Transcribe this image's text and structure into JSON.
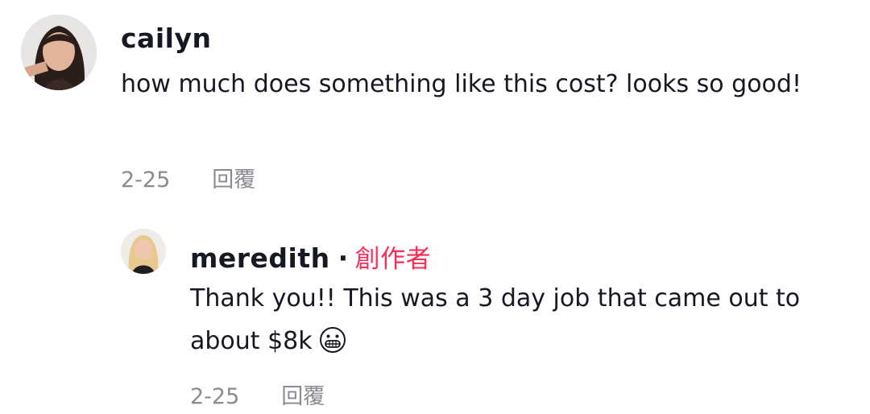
{
  "comments": [
    {
      "username": "cailyn",
      "text": "how much does something like this cost? looks so good!",
      "date": "2-25",
      "reply_label": "回覆"
    },
    {
      "username": "meredith",
      "separator": "·",
      "badge": "創作者",
      "text": "Thank you!! This was a 3 day job that came out to about $8k",
      "emoji": "grimacing-face",
      "date": "2-25",
      "reply_label": "回覆"
    }
  ],
  "colors": {
    "username": "#161823",
    "creator_badge": "#fe2c55",
    "meta": "#8a8b91"
  }
}
